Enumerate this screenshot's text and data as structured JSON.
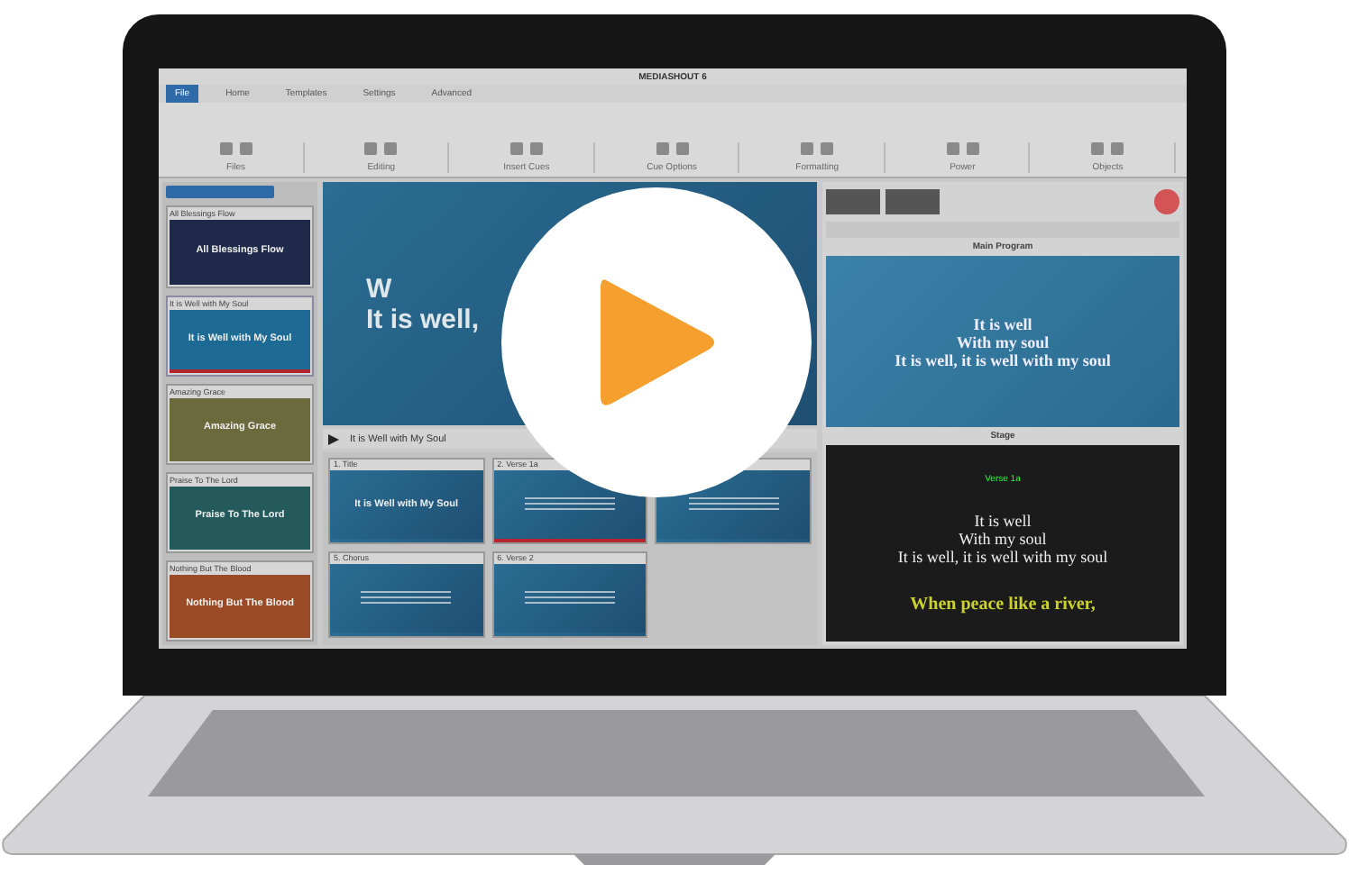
{
  "app": {
    "title": "MEDIASHOUT 6",
    "menu_tabs": [
      {
        "label": "File",
        "selected": true
      },
      {
        "label": "Home",
        "selected": false
      },
      {
        "label": "Templates",
        "selected": false
      },
      {
        "label": "Settings",
        "selected": false
      },
      {
        "label": "Advanced",
        "selected": false
      }
    ],
    "ribbon_groups": [
      "Files",
      "Editing",
      "Insert Cues",
      "Cue Options",
      "Formatting",
      "Power",
      "Objects"
    ],
    "cue_list": [
      {
        "label": "All Blessings Flow",
        "slide_title": "All Blessings Flow",
        "color": "#1f2a4a",
        "selected": false
      },
      {
        "label": "It is Well with My Soul",
        "slide_title": "It is Well with My Soul",
        "color": "#1d6a94",
        "selected": true
      },
      {
        "label": "Amazing Grace",
        "slide_title": "Amazing Grace",
        "color": "#6b6a3c",
        "selected": false
      },
      {
        "label": "Praise To The Lord",
        "slide_title": "Praise To The Lord",
        "color": "#245a5c",
        "selected": false
      },
      {
        "label": "Nothing But The Blood",
        "slide_title": "Nothing But The Blood",
        "color": "#9a4a25",
        "selected": false
      }
    ],
    "preview_lines": [
      "W",
      "It is well,"
    ],
    "current_cue": "It is Well with My Soul",
    "slides": [
      {
        "label": "1. Title",
        "heading": "It is Well with My Soul",
        "selected": false
      },
      {
        "label": "2. Verse 1a",
        "selected": true
      },
      {
        "selected": false
      },
      {
        "label": "5. Chorus",
        "selected": false
      },
      {
        "label": "6. Verse 2",
        "selected": false
      }
    ],
    "main_program": {
      "label": "Main Program",
      "lines": [
        "It is well",
        "With my soul",
        "It is well, it is well with my soul"
      ]
    },
    "stage": {
      "label": "Stage",
      "cue": "Verse 1a",
      "lines": [
        "It is well",
        "With my soul",
        "It is well, it is well with my soul"
      ],
      "next_line": "When peace like a river,"
    }
  }
}
